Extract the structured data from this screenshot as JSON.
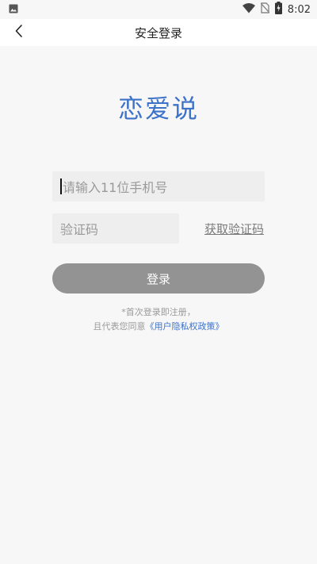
{
  "status_bar": {
    "time": "8:02",
    "icons": [
      "image-icon",
      "wifi-icon",
      "no-sim-icon",
      "battery-charging-icon"
    ]
  },
  "app_bar": {
    "title": "安全登录",
    "back_icon": "chevron-left-icon"
  },
  "logo": {
    "text": "恋爱说",
    "color": "#3d72c9"
  },
  "form": {
    "phone_placeholder": "请输入11位手机号",
    "code_placeholder": "验证码",
    "get_code_label": "获取验证码",
    "login_label": "登录"
  },
  "agreement": {
    "line1": "*首次登录即注册，",
    "line2_prefix": "且代表您同意",
    "policy_link": "《用户隐私权政策》"
  },
  "colors": {
    "accent": "#3d72c9",
    "button": "#939393",
    "input_bg": "#eeeeee"
  }
}
